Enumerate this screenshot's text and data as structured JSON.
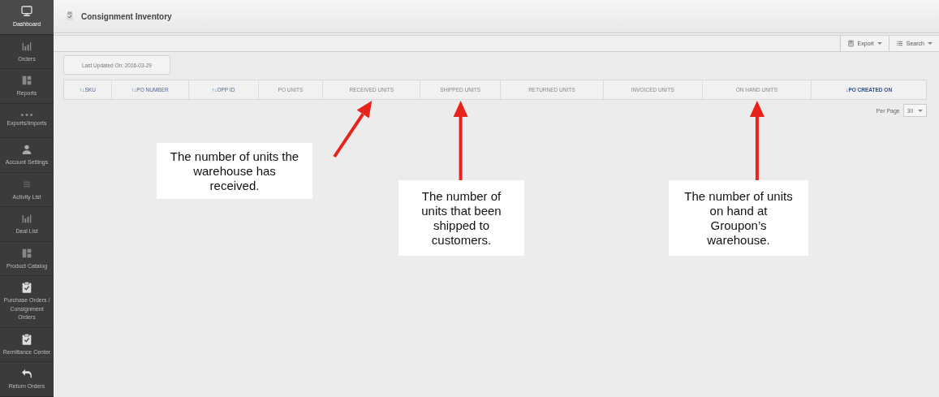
{
  "sidebar": {
    "items": [
      {
        "label": "Dashboard",
        "selected": true
      },
      {
        "label": "Orders",
        "selected": false
      },
      {
        "label": "Reports",
        "selected": false
      },
      {
        "label": "Exports/Imports",
        "selected": false
      },
      {
        "label": "Account Settings",
        "selected": false
      },
      {
        "label": "Activity List",
        "selected": false
      },
      {
        "label": "Deal List",
        "selected": false
      },
      {
        "label": "Product Catalog",
        "selected": false
      },
      {
        "label": "Purchase Orders / Consignment Orders",
        "selected": false
      },
      {
        "label": "Remittance Center",
        "selected": false
      },
      {
        "label": "Return Orders",
        "selected": false
      }
    ]
  },
  "header": {
    "title": "Consignment Inventory"
  },
  "toolbar": {
    "buttons": [
      {
        "label": "Export"
      },
      {
        "label": "Search"
      }
    ]
  },
  "last_updated": "Last Updated On: 2016-03-29",
  "table": {
    "columns": [
      {
        "label": "↑↓SKU",
        "kind": "sortable"
      },
      {
        "label": "↑↓PO NUMBER",
        "kind": "sortable"
      },
      {
        "label": "↑↓OPP ID",
        "kind": "sortable"
      },
      {
        "label": "PO UNITS",
        "kind": "plain"
      },
      {
        "label": "RECEIVED UNITS",
        "kind": "plain"
      },
      {
        "label": "SHIPPED UNITS",
        "kind": "plain"
      },
      {
        "label": "RETURNED UNITS",
        "kind": "plain"
      },
      {
        "label": "INVOICED UNITS",
        "kind": "plain"
      },
      {
        "label": "ON HAND UNITS",
        "kind": "plain"
      },
      {
        "label": "↓PO CREATED ON",
        "kind": "sorted"
      }
    ]
  },
  "pagination": {
    "label": "Per Page",
    "value": "30"
  },
  "callouts": [
    {
      "text": "The number of units the warehouse has received."
    },
    {
      "text": "The number of units that been shipped to customers."
    },
    {
      "text": "The number of units on hand at Groupon’s warehouse."
    }
  ]
}
